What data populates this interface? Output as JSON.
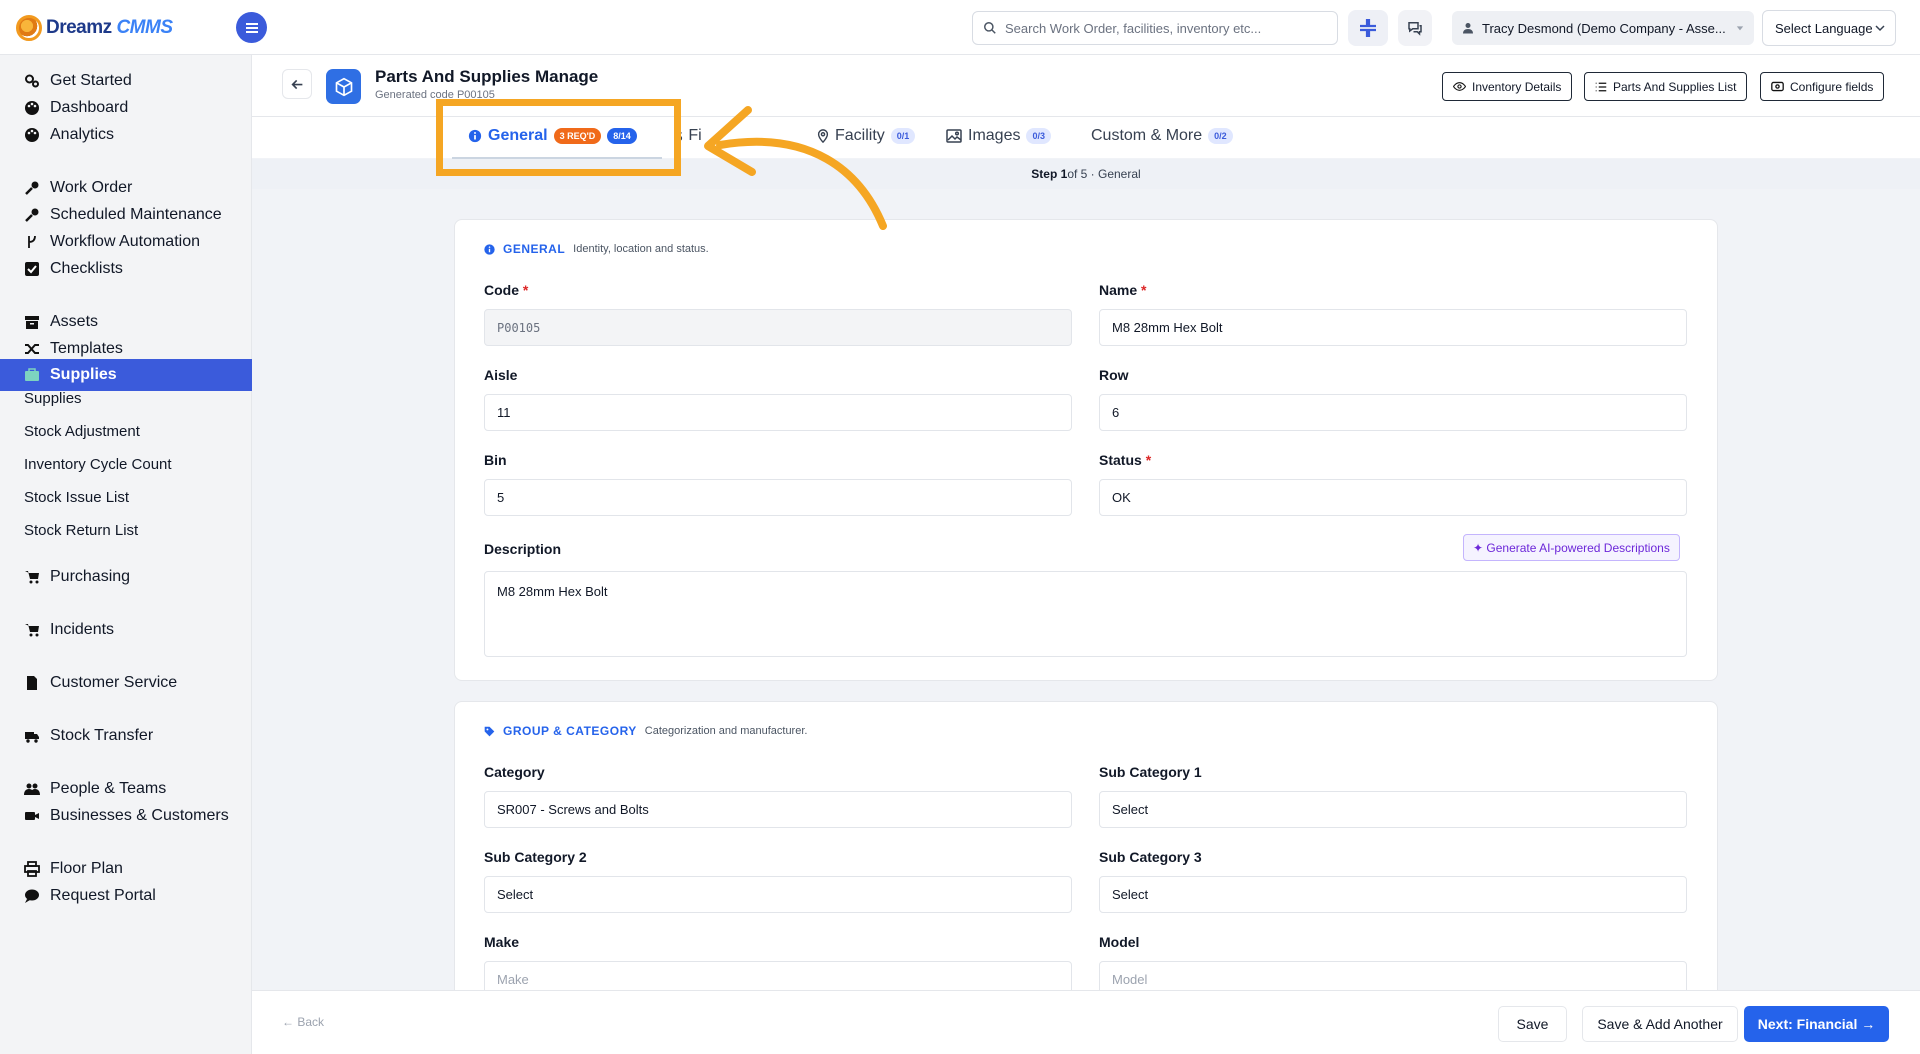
{
  "app": {
    "logo_text_1": "Dreamz",
    "logo_text_2": "CMMS",
    "search_placeholder": "Search Work Order, facilities, inventory etc...",
    "user_label": "Tracy Desmond (Demo Company - Asse...",
    "language_label": "Select Language"
  },
  "sidebar": {
    "items": [
      {
        "label": "Get Started",
        "icon": "gears-icon"
      },
      {
        "label": "Dashboard",
        "icon": "palette-icon"
      },
      {
        "label": "Analytics",
        "icon": "palette-icon"
      },
      {
        "label": "Work Order",
        "icon": "wrench-icon"
      },
      {
        "label": "Scheduled Maintenance",
        "icon": "wrench-icon"
      },
      {
        "label": "Workflow Automation",
        "icon": "flow-icon"
      },
      {
        "label": "Checklists",
        "icon": "checkbox-icon"
      },
      {
        "label": "Assets",
        "icon": "archive-icon"
      },
      {
        "label": "Templates",
        "icon": "shuffle-icon"
      },
      {
        "label": "Supplies",
        "icon": "briefcase-icon"
      },
      {
        "label": "Purchasing",
        "icon": "cart-icon"
      },
      {
        "label": "Incidents",
        "icon": "cart-icon"
      },
      {
        "label": "Customer Service",
        "icon": "file-icon"
      },
      {
        "label": "Stock Transfer",
        "icon": "truck-icon"
      },
      {
        "label": "People & Teams",
        "icon": "users-icon"
      },
      {
        "label": "Businesses & Customers",
        "icon": "video-icon"
      },
      {
        "label": "Floor Plan",
        "icon": "printer-icon"
      },
      {
        "label": "Request Portal",
        "icon": "chat-icon"
      }
    ],
    "sub_items": [
      "Supplies",
      "Stock Adjustment",
      "Inventory Cycle Count",
      "Stock Issue List",
      "Stock Return List"
    ]
  },
  "page": {
    "title": "Parts And Supplies Manage",
    "subtitle": "Generated code P00105",
    "buttons": {
      "inventory_details": "Inventory Details",
      "parts_list": "Parts And Supplies List",
      "configure_fields": "Configure fields"
    }
  },
  "tabs": [
    {
      "label": "General",
      "badge1": "3 REQ'D",
      "badge2": "8/14"
    },
    {
      "label": "Fi",
      "badge1": ""
    },
    {
      "label": "Facility",
      "badge1": "0/1"
    },
    {
      "label": "Images",
      "badge1": "0/3"
    },
    {
      "label": "Custom & More",
      "badge1": "0/2"
    }
  ],
  "step": {
    "prefix": "Step 1",
    "rest": " of 5 · General"
  },
  "general": {
    "title": "GENERAL",
    "desc": "Identity, location and status.",
    "code_label": "Code",
    "code_value": "P00105",
    "name_label": "Name",
    "name_value": "M8 28mm Hex Bolt",
    "aisle_label": "Aisle",
    "aisle_value": "11",
    "row_label": "Row",
    "row_value": "6",
    "bin_label": "Bin",
    "bin_value": "5",
    "status_label": "Status",
    "status_value": "OK",
    "description_label": "Description",
    "description_value": "M8 28mm Hex Bolt",
    "ai_button": "✦ Generate AI-powered Descriptions",
    "required_mark": "*"
  },
  "group": {
    "title": "GROUP & CATEGORY",
    "desc": "Categorization and manufacturer.",
    "category_label": "Category",
    "category_value": "SR007 - Screws and Bolts",
    "sub1_label": "Sub Category 1",
    "sub1_value": "Select",
    "sub2_label": "Sub Category 2",
    "sub2_value": "Select",
    "sub3_label": "Sub Category 3",
    "sub3_value": "Select",
    "make_label": "Make",
    "make_placeholder": "Make",
    "model_label": "Model",
    "model_placeholder": "Model"
  },
  "footer": {
    "back": "← Back",
    "save": "Save",
    "save_add": "Save & Add Another",
    "next": "Next: Financial →"
  },
  "colors": {
    "primary": "#2563eb",
    "sidebar_active": "#3b5bdb",
    "annotation": "#f5a623",
    "required": "#dc2626"
  }
}
